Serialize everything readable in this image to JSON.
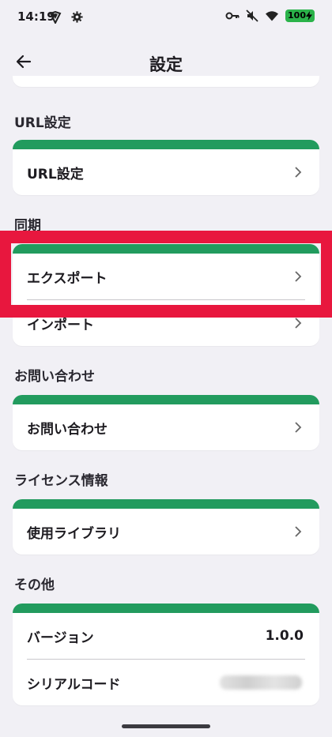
{
  "status": {
    "time": "14:19",
    "battery": "100"
  },
  "header": {
    "title": "設定"
  },
  "sections": {
    "url": {
      "label": "URL設定",
      "items": [
        "URL設定"
      ]
    },
    "sync": {
      "label": "同期",
      "items": [
        "エクスポート",
        "インポート"
      ]
    },
    "contact": {
      "label": "お問い合わせ",
      "items": [
        "お問い合わせ"
      ]
    },
    "license": {
      "label": "ライセンス情報",
      "items": [
        "使用ライブラリ"
      ]
    },
    "other": {
      "label": "その他",
      "version_label": "バージョン",
      "version_value": "1.0.0",
      "serial_label": "シリアルコード"
    }
  },
  "colors": {
    "accent": "#229b5e",
    "highlight": "#e8173e",
    "background": "#f1f0f5"
  }
}
